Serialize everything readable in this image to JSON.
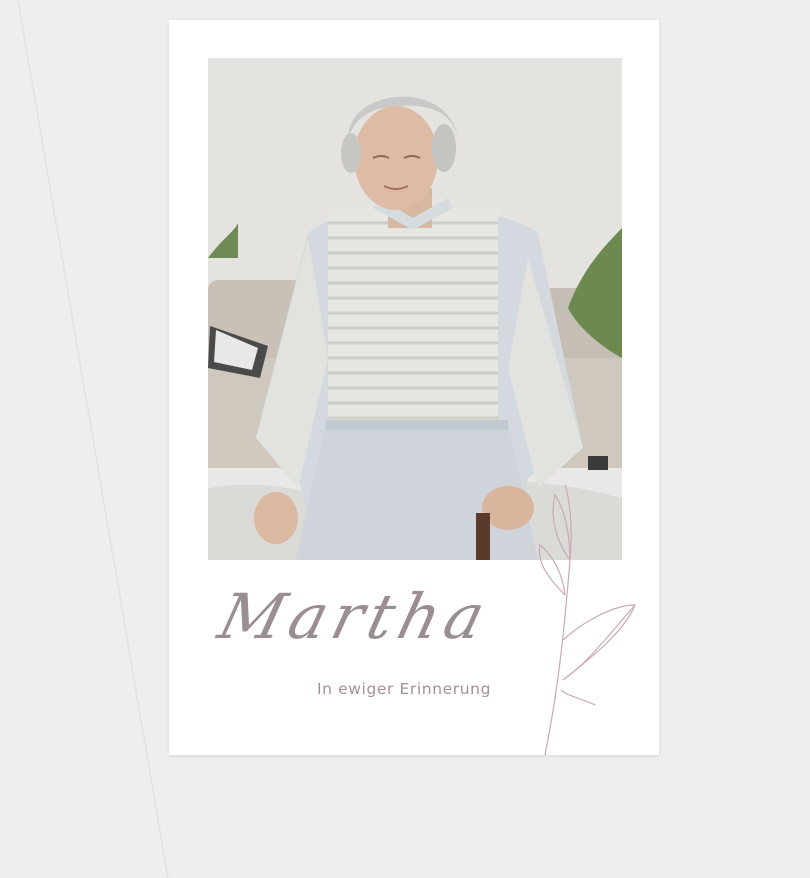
{
  "card": {
    "name": "Martha",
    "subtitle": "In ewiger Erinnerung"
  },
  "colors": {
    "background": "#eeeeee",
    "card": "#ffffff",
    "name_text": "#9a8e92",
    "subtitle_text": "#a88f97",
    "floral_line": "#c9a9b3"
  },
  "photo": {
    "description_icon": "portrait-photo"
  }
}
